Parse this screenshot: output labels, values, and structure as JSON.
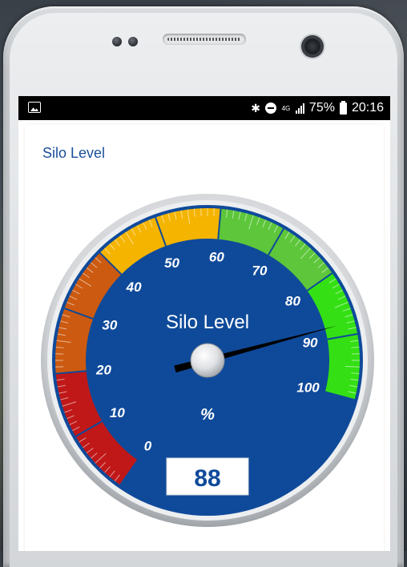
{
  "status_bar": {
    "battery": "75%",
    "time": "20:16",
    "network": "4G"
  },
  "app": {
    "title": "Silo Level"
  },
  "gauge": {
    "title": "Silo Level",
    "unit": "%",
    "value": 88,
    "value_display": "88",
    "min": 0,
    "max": 100,
    "scale_labels": [
      "0",
      "10",
      "20",
      "30",
      "40",
      "50",
      "60",
      "70",
      "80",
      "90",
      "100"
    ],
    "colors": {
      "face": "#0f4a9a",
      "red": "#c01818",
      "orange": "#cc5a10",
      "yellow": "#f4b400",
      "light_green": "#5dc63a",
      "green": "#34e014",
      "needle": "#000000"
    },
    "bands": [
      {
        "from": 0,
        "to": 20,
        "color": "red"
      },
      {
        "from": 20,
        "to": 40,
        "color": "orange"
      },
      {
        "from": 40,
        "to": 60,
        "color": "yellow"
      },
      {
        "from": 60,
        "to": 80,
        "color": "light_green"
      },
      {
        "from": 80,
        "to": 100,
        "color": "green"
      }
    ]
  }
}
